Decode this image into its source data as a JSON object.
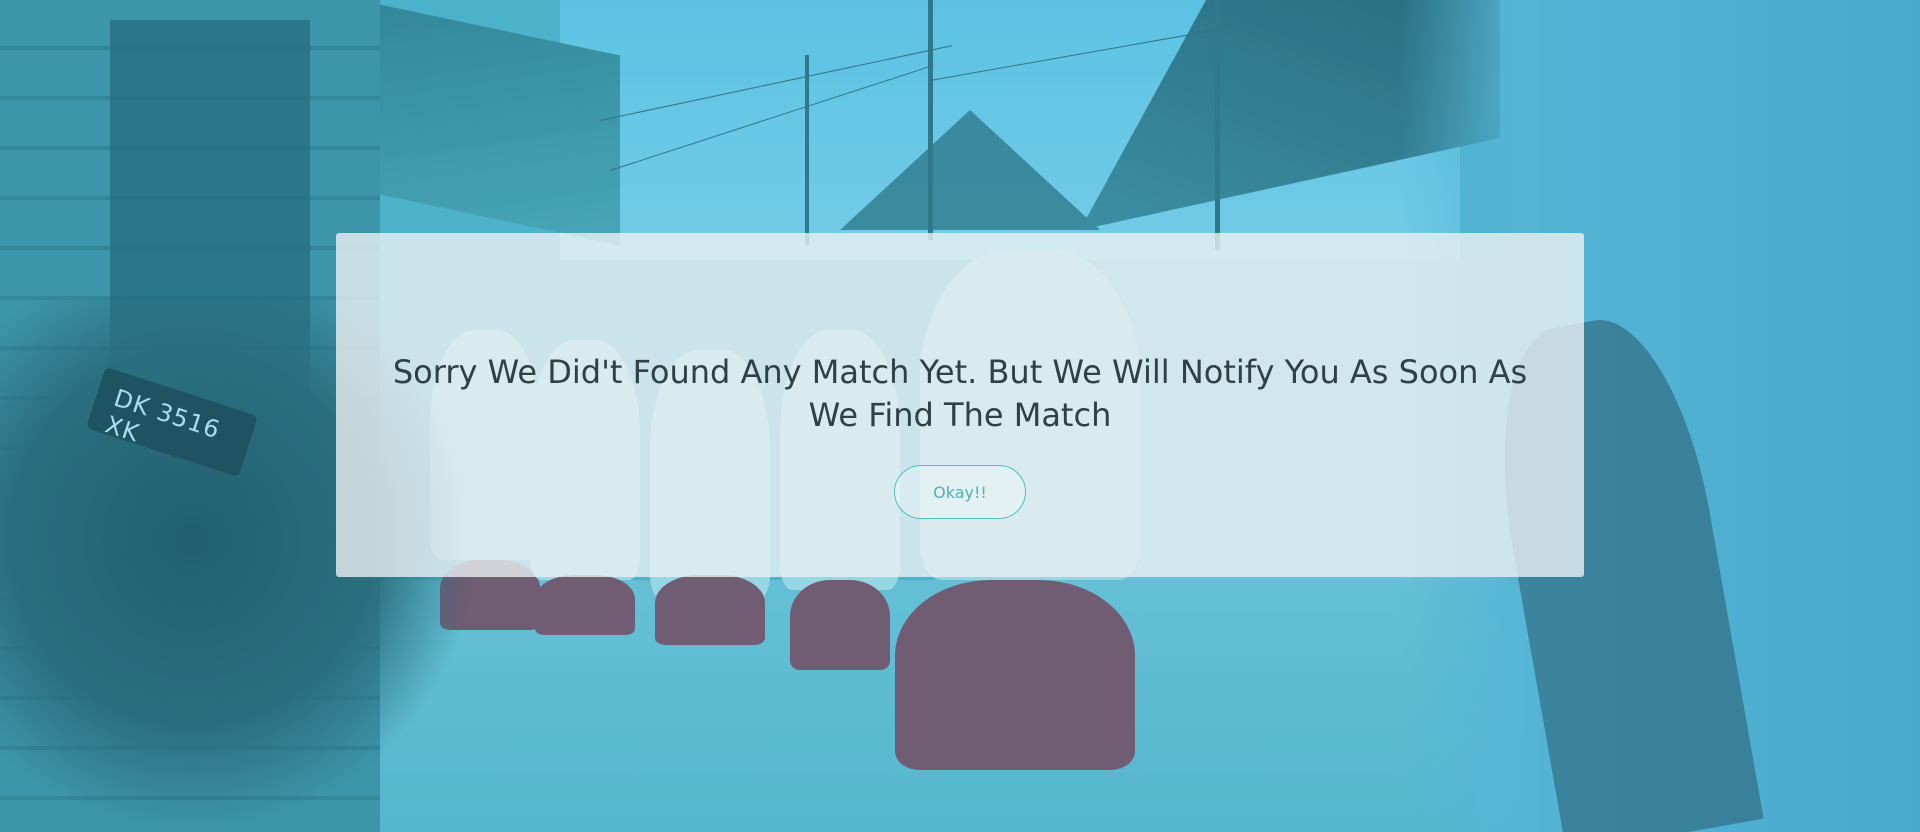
{
  "dialog": {
    "message": "Sorry We Did't Found Any Match Yet. But We Will Notify You As Soon As We Find The Match",
    "button_label": "Okay!!"
  },
  "background": {
    "plate_text": "DK 3516 XK"
  },
  "colors": {
    "overlay_tint": "#40b4d2",
    "button_accent": "#4fc2c0",
    "message_text": "#2f4046"
  }
}
